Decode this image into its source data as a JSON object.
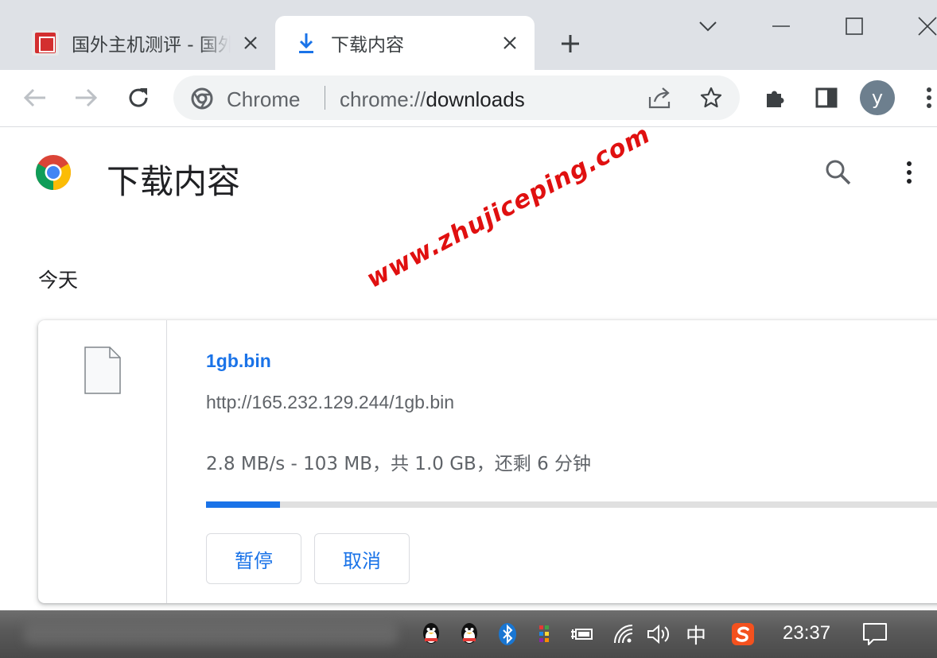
{
  "tabs": [
    {
      "title": "国外主机测评 - 国外",
      "active": false
    },
    {
      "title": "下载内容",
      "active": true
    }
  ],
  "omnibox": {
    "site_label": "Chrome",
    "url_scheme": "chrome://",
    "url_host": "downloads"
  },
  "profile": {
    "initial": "y"
  },
  "page": {
    "title": "下载内容",
    "date_group": "今天"
  },
  "download": {
    "file_name": "1gb.bin",
    "url": "http://165.232.129.244/1gb.bin",
    "status": "2.8 MB/s - 103 MB，共 1.0 GB，还剩 6 分钟",
    "progress_fraction": 0.103,
    "pause_label": "暂停",
    "cancel_label": "取消"
  },
  "watermark": "www.zhujiceping.com",
  "taskbar": {
    "ime_label": "中",
    "clock": "23:37"
  },
  "colors": {
    "accent": "#1a73e8",
    "tabstrip": "#dee1e6",
    "omnibox": "#f1f3f4",
    "watermark": "#e01010",
    "avatar": "#6d7f8e"
  },
  "icons": [
    "site-favicon",
    "download-icon",
    "close-icon",
    "plus-icon",
    "chevron-down-icon",
    "minimize-icon",
    "maximize-icon",
    "window-close-icon",
    "back-arrow-icon",
    "forward-arrow-icon",
    "reload-icon",
    "chrome-icon",
    "share-icon",
    "star-icon",
    "extensions-icon",
    "side-panel-icon",
    "more-vert-icon",
    "search-icon",
    "file-icon",
    "qq-icon",
    "bluetooth-icon",
    "power-icon",
    "wifi-icon",
    "volume-icon",
    "sogou-icon",
    "notification-icon"
  ]
}
